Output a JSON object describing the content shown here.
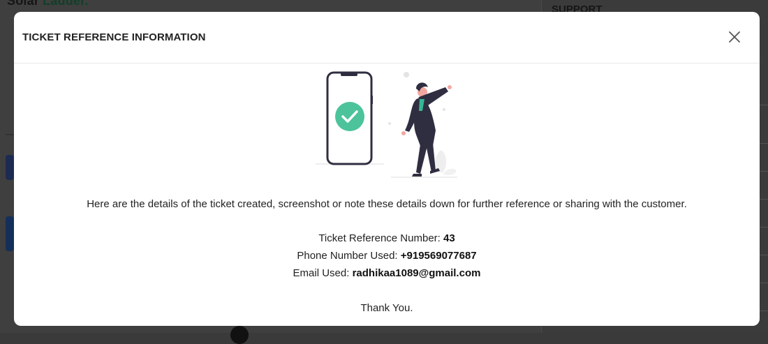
{
  "background": {
    "brand_part1": "Solar",
    "brand_part2": "Ladder.",
    "support_heading": "SUPPORT"
  },
  "modal": {
    "title": "TICKET REFERENCE INFORMATION",
    "close_icon": "close-icon",
    "illustration_icon": "success-check-icon",
    "intro_text": "Here are the details of the ticket created, screenshot or note these details down for further reference or sharing with the customer.",
    "ticket_label": "Ticket Reference Number:",
    "ticket_value": "43",
    "phone_label": "Phone Number Used:",
    "phone_value": "+919569077687",
    "email_label": "Email Used:",
    "email_value": "radhikaa1089@gmail.com",
    "thanks_text": "Thank You."
  },
  "colors": {
    "success_green": "#4cc39b",
    "figure_dark": "#2f2e41",
    "figure_accent": "#38b593",
    "skin": "#f2a7a0"
  }
}
